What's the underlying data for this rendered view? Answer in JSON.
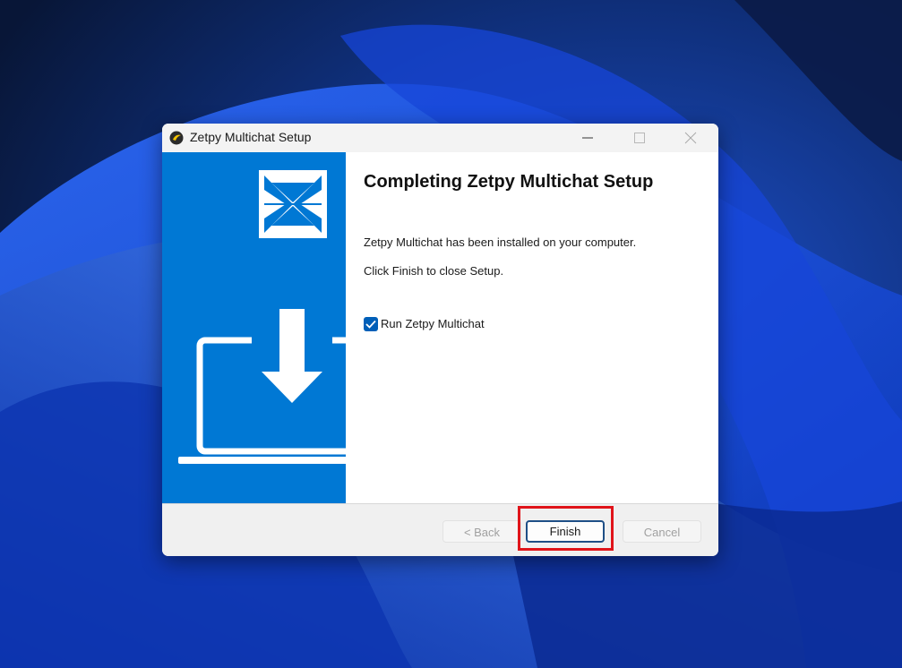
{
  "window": {
    "title": "Zetpy Multichat Setup"
  },
  "content": {
    "heading": "Completing Zetpy Multichat Setup",
    "line1": "Zetpy Multichat has been installed on your computer.",
    "line2": "Click Finish to close Setup.",
    "checkbox_label": "Run Zetpy Multichat",
    "checkbox_checked": true
  },
  "buttons": {
    "back": "< Back",
    "finish": "Finish",
    "cancel": "Cancel"
  },
  "icons": {
    "app": "zetpy-app-icon",
    "minimize": "minimize-icon",
    "maximize": "maximize-icon",
    "close": "close-icon",
    "logo": "zetpy-logo-icon",
    "install": "laptop-download-icon",
    "check": "checkmark-icon"
  },
  "colors": {
    "accent": "#0078d4",
    "checkbox": "#005fb8",
    "highlight": "#e0141a"
  }
}
